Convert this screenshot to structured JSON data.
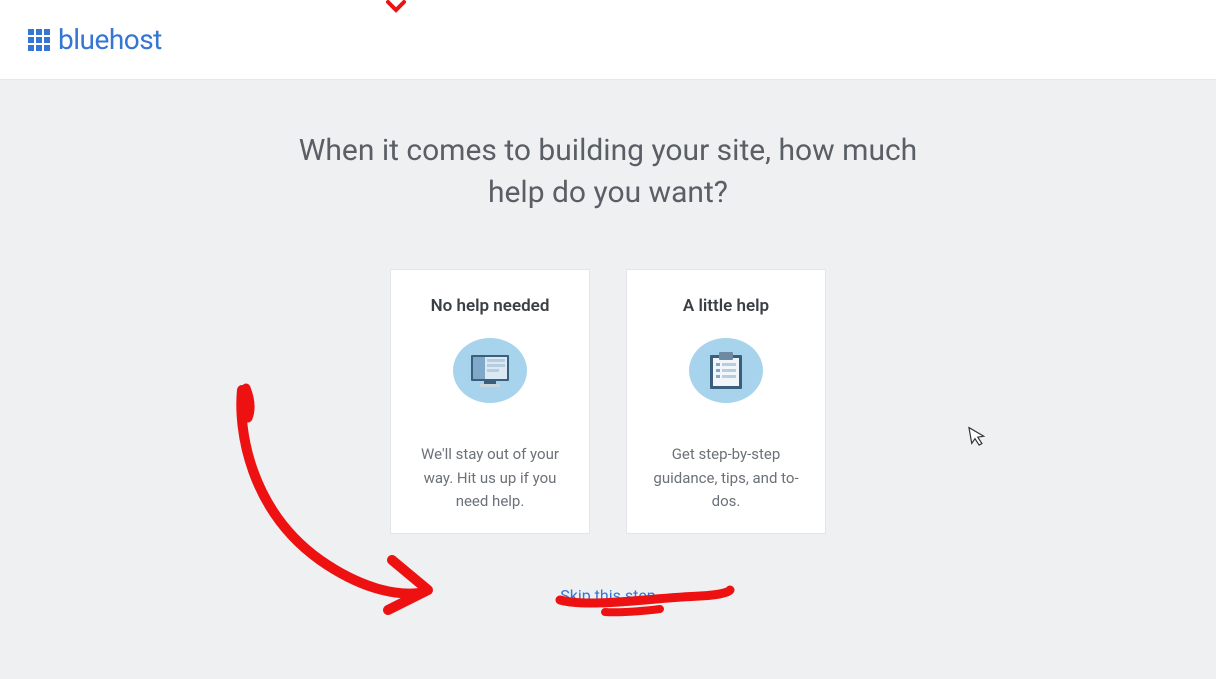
{
  "brand": {
    "name": "bluehost"
  },
  "question": "When it comes to building your site, how much help do you want?",
  "cards": [
    {
      "title": "No help needed",
      "desc": "We'll stay out of your way. Hit us up if you need help.",
      "icon": "monitor-icon"
    },
    {
      "title": "A little help",
      "desc": "Get step-by-step guidance, tips, and to-dos.",
      "icon": "checklist-icon"
    }
  ],
  "skip_label": "Skip this step"
}
